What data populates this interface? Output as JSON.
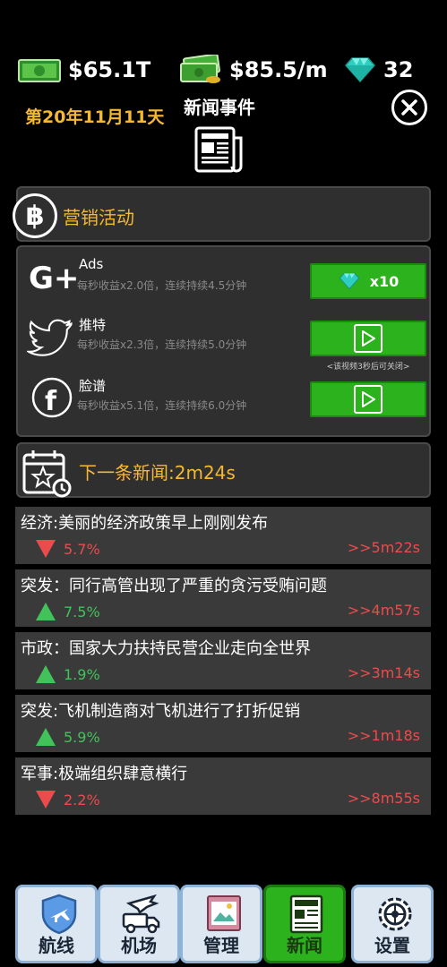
{
  "stats": {
    "cash": "$65.1T",
    "rate": "$85.5/m",
    "gems": "32"
  },
  "date": "第20年11月11天",
  "title": "新闻事件",
  "marketing": {
    "title": "营销活动",
    "items": [
      {
        "name": "Ads",
        "desc": "每秒收益x2.0倍，连续持续4.5分钟",
        "button": "x10",
        "icon": "google-plus-icon"
      },
      {
        "name": "推特",
        "desc": "每秒收益x2.3倍，连续持续5.0分钟",
        "note": "<该视频3秒后可关闭>",
        "icon": "twitter-icon"
      },
      {
        "name": "脸谱",
        "desc": "每秒收益x5.1倍，连续持续6.0分钟",
        "icon": "facebook-icon"
      }
    ]
  },
  "next_news": "下一条新闻:2m24s",
  "news": [
    {
      "headline": "经济:美丽的经济政策早上刚刚发布",
      "trend": "down",
      "pct": "5.7%",
      "time": ">>5m22s"
    },
    {
      "headline": "突发：同行高管出现了严重的贪污受贿问题",
      "trend": "up",
      "pct": "7.5%",
      "time": ">>4m57s"
    },
    {
      "headline": "市政：国家大力扶持民营企业走向全世界",
      "trend": "up",
      "pct": "1.9%",
      "time": ">>3m14s"
    },
    {
      "headline": "突发:飞机制造商对飞机进行了打折促销",
      "trend": "up",
      "pct": "5.9%",
      "time": ">>1m18s"
    },
    {
      "headline": "军事:极端组织肆意横行",
      "trend": "down",
      "pct": "2.2%",
      "time": ">>8m55s"
    }
  ],
  "nav": [
    {
      "label": "航线",
      "icon": "shield-plane-icon"
    },
    {
      "label": "机场",
      "icon": "truck-plane-icon"
    },
    {
      "label": "管理",
      "icon": "papers-icon"
    },
    {
      "label": "新闻",
      "icon": "newspaper-icon",
      "active": true
    },
    {
      "label": "设置",
      "icon": "gear-icon"
    }
  ],
  "colors": {
    "accent": "#f5b931",
    "green_button": "#2cb21c",
    "up": "#41c35a",
    "down": "#ea4c4c",
    "panel": "#2f2f2f"
  }
}
